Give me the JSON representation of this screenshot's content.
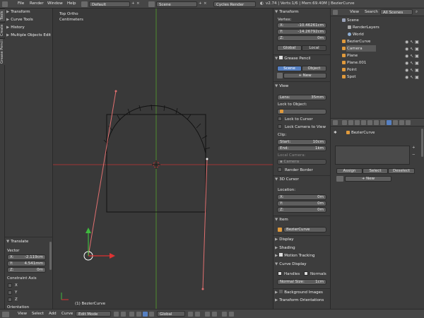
{
  "topbar": {
    "menus": [
      "File",
      "Render",
      "Window",
      "Help"
    ],
    "screen_layout": "Default",
    "scene": "Scene",
    "engine": "Cycles Render",
    "stats": "v2.74 | Verts:1/6 | Mem:69.40M | BezierCurve"
  },
  "left_tabs": [
    "Tools",
    "Create",
    "Grease Pencil"
  ],
  "toolshelf": {
    "panels": [
      "Transform",
      "Curve Tools",
      "History",
      "Multiple Objects Edit"
    ],
    "operator": {
      "title": "Translate",
      "vector_label": "Vector",
      "x_label": "X:",
      "x_value": "-2.119cm",
      "y_label": "Y:",
      "y_value": "4.541mm",
      "z_label": "Z:",
      "z_value": "0m",
      "constraint_label": "Constraint Axis",
      "axes": [
        "X",
        "Y",
        "Z"
      ],
      "orientation_label": "Orientation"
    }
  },
  "viewport": {
    "view_name": "Top Ortho",
    "units": "Centimeters",
    "object_label": "(1) BezierCurve"
  },
  "npanel": {
    "transform_title": "Transform",
    "vertex_label": "Vertex:",
    "x_label": "X:",
    "x_value": "-10.46261cm",
    "y_label": "Y:",
    "y_value": "-14.26792cm",
    "z_label": "Z:",
    "z_value": "0m",
    "global": "Global",
    "local": "Local",
    "grease_title": "Grease Pencil",
    "scene_btn": "Scene",
    "object_btn": "Object",
    "new_btn": "New",
    "view_title": "View",
    "lens_label": "Lens:",
    "lens_value": "35mm",
    "lock_object": "Lock to Object:",
    "lock_cursor": "Lock to Cursor",
    "lock_camera": "Lock Camera to View",
    "clip_label": "Clip:",
    "start_label": "Start:",
    "start_value": "10cm",
    "end_label": "End:",
    "end_value": "1km",
    "local_camera": "Local Camera:",
    "camera_value": "Camera",
    "render_border": "Render Border",
    "cursor_title": "3D Cursor",
    "location_label": "Location:",
    "cx_label": "X:",
    "cx_value": "0m",
    "cy_label": "Y:",
    "cy_value": "0m",
    "cz_label": "Z:",
    "cz_value": "0m",
    "item_title": "Item",
    "item_name": "BezierCurve",
    "display_title": "Display",
    "shading_title": "Shading",
    "motion_title": "Motion Tracking",
    "curve_display_title": "Curve Display",
    "handles": "Handles",
    "normals": "Normals",
    "normal_size_label": "Normal Size:",
    "normal_size_value": "1cm",
    "bg_images": "Background Images",
    "transform_orient": "Transform Orientations"
  },
  "outliner": {
    "tabs": [
      "View",
      "Search",
      "All Scenes"
    ],
    "items": [
      {
        "label": "Scene",
        "color": "#9aa2b8"
      },
      {
        "label": "RenderLayers",
        "color": "#a8a8a8"
      },
      {
        "label": "World",
        "color": "#8fb0d6"
      },
      {
        "label": "BezierCurve",
        "color": "#e09a3c"
      },
      {
        "label": "Camera",
        "color": "#e09a3c"
      },
      {
        "label": "Plane",
        "color": "#e09a3c"
      },
      {
        "label": "Plane.001",
        "color": "#e09a3c"
      },
      {
        "label": "Point",
        "color": "#e09a3c"
      },
      {
        "label": "Spot",
        "color": "#e09a3c"
      }
    ]
  },
  "properties": {
    "object_name": "BezierCurve",
    "assign": "Assign",
    "select": "Select",
    "deselect": "Deselect",
    "new_btn": "New"
  },
  "bottombar": {
    "menus": [
      "View",
      "Select",
      "Add",
      "Curve"
    ],
    "mode": "Edit Mode",
    "orientation": "Global"
  },
  "colors": {
    "accent": "#5680c2",
    "object_orange": "#e09a3c",
    "x_axis": "#a03535",
    "y_axis": "#4e8a2e",
    "handle": "#e06f6f"
  }
}
